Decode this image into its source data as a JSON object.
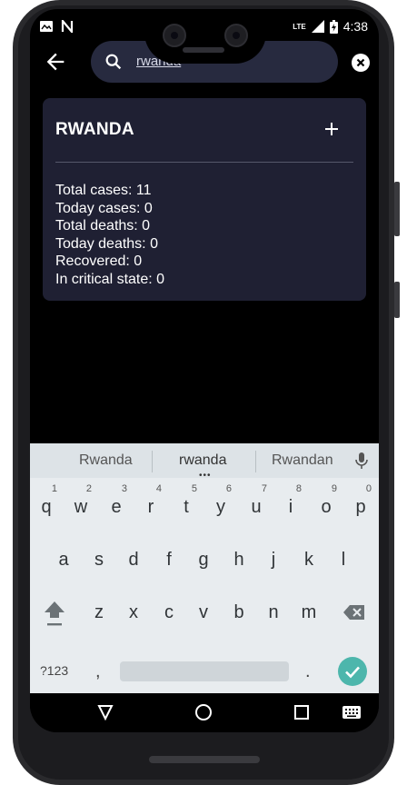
{
  "status_bar": {
    "time": "4:38",
    "network_label": "LTE"
  },
  "search": {
    "query": "rwanda"
  },
  "country_card": {
    "name": "RWANDA",
    "stats": [
      "Total cases: 11",
      "Today cases: 0",
      "Total deaths: 0",
      "Today deaths: 0",
      "Recovered: 0",
      "In critical state: 0"
    ]
  },
  "keyboard": {
    "suggestions": [
      "Rwanda",
      "rwanda",
      "Rwandan"
    ],
    "row1": [
      {
        "key": "q",
        "hint": "1"
      },
      {
        "key": "w",
        "hint": "2"
      },
      {
        "key": "e",
        "hint": "3"
      },
      {
        "key": "r",
        "hint": "4"
      },
      {
        "key": "t",
        "hint": "5"
      },
      {
        "key": "y",
        "hint": "6"
      },
      {
        "key": "u",
        "hint": "7"
      },
      {
        "key": "i",
        "hint": "8"
      },
      {
        "key": "o",
        "hint": "9"
      },
      {
        "key": "p",
        "hint": "0"
      }
    ],
    "row2": [
      "a",
      "s",
      "d",
      "f",
      "g",
      "h",
      "j",
      "k",
      "l"
    ],
    "row3": [
      "z",
      "x",
      "c",
      "v",
      "b",
      "n",
      "m"
    ],
    "symbols_label": "?123",
    "comma_label": ",",
    "period_label": "."
  },
  "colors": {
    "card_background": "#1f2033",
    "search_background": "#272a3f",
    "enter_key": "#4db6ac",
    "keyboard_background": "#e8ecef"
  }
}
